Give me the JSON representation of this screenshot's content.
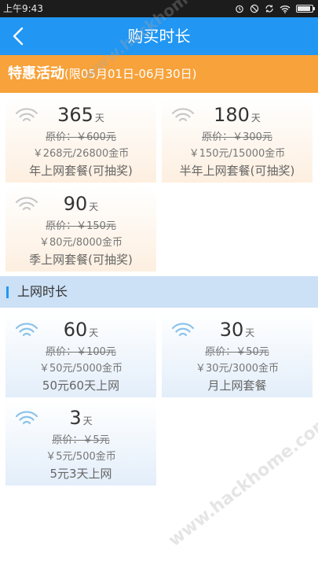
{
  "statusbar": {
    "time": "上午9:43",
    "battery_level": 0.9,
    "icons": [
      "alarm-icon",
      "silent-icon",
      "sync-icon",
      "wifi-icon",
      "battery-icon"
    ]
  },
  "titlebar": {
    "title": "购买时长",
    "back_icon": "chevron-left-icon"
  },
  "promo": {
    "title": "特惠活动",
    "period": "(限05月01日-06月30日)"
  },
  "promo_cards": [
    {
      "days": "365",
      "unit": "天",
      "original": "原价：￥600元",
      "price": "￥268元/26800金币",
      "name": "年上网套餐(可抽奖)"
    },
    {
      "days": "180",
      "unit": "天",
      "original": "原价：￥300元",
      "price": "￥150元/15000金币",
      "name": "半年上网套餐(可抽奖)"
    },
    {
      "days": "90",
      "unit": "天",
      "original": "原价：￥150元",
      "price": "￥80元/8000金币",
      "name": "季上网套餐(可抽奖)"
    }
  ],
  "section": {
    "title": "上网时长"
  },
  "plan_cards": [
    {
      "days": "60",
      "unit": "天",
      "original": "原价：￥100元",
      "price": "￥50元/5000金币",
      "name": "50元60天上网"
    },
    {
      "days": "30",
      "unit": "天",
      "original": "原价：￥50元",
      "price": "￥30元/3000金币",
      "name": "月上网套餐"
    },
    {
      "days": "3",
      "unit": "天",
      "original": "原价：￥5元",
      "price": "￥5元/500金币",
      "name": "5元3天上网"
    }
  ],
  "colors": {
    "titlebar": "#2196f3",
    "promo_banner": "#f7a23a",
    "promo_icon": "#c8c8c8",
    "plan_icon": "#8ac2ea",
    "section_header": "#cce0f6"
  },
  "watermark": {
    "text1": "www.hackhome.com",
    "text2": "www.hackhome.com"
  }
}
